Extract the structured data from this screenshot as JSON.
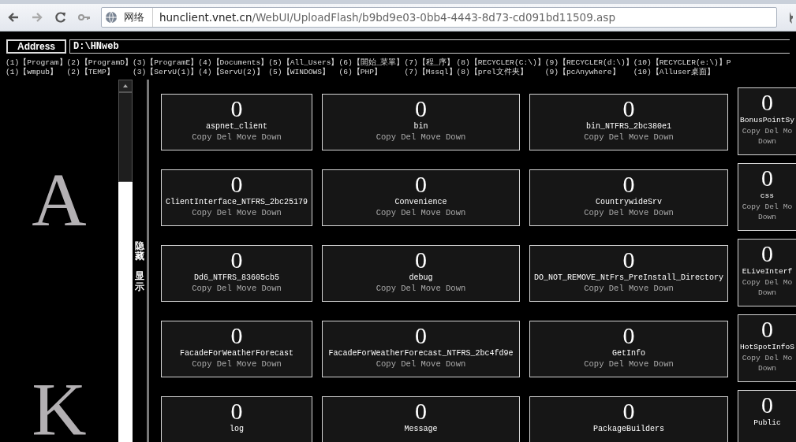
{
  "browser": {
    "address_label": "网络",
    "url_host": "hunclient.vnet.cn",
    "url_path": "/WebUI/UploadFlash/b9bd9e03-0bb4-4443-8d73-cd091bd11509.asp"
  },
  "address_bar": {
    "label": "Address",
    "value": "D:\\HNweb"
  },
  "quick_links": [
    [
      "(1)【Program】",
      "(2)【ProgramD】",
      "(3)【ProgramE】",
      "(4)【Documents】",
      "(5)【All_Users】",
      "(6)【開始_菜單】",
      "(7)【程_序】",
      "(8)【RECYCLER(C:\\)】",
      "(9)【RECYCLER(d:\\)】",
      "(10)【RECYCLER(e:\\)】",
      "P"
    ],
    [
      "(1)【wmpub】",
      "(2)【TEMP】",
      "(3)【ServU(1)】",
      "(4)【ServU(2)】",
      "(5)【WINDOWS】",
      "(6)【PHP】",
      "(7)【Mssql】",
      "(8)【prel文件夹】",
      "(9)【pcAnywhere】",
      "(10)【Alluser桌面】"
    ]
  ],
  "index_letters": [
    "A",
    "K"
  ],
  "toggle": {
    "hide": "隐藏",
    "show": "显示"
  },
  "folders": [
    {
      "count": "0",
      "name": "aspnet_client",
      "actions": [
        "Copy",
        "Del",
        "Move",
        "Down"
      ]
    },
    {
      "count": "0",
      "name": "bin",
      "actions": [
        "Copy",
        "Del",
        "Move",
        "Down"
      ]
    },
    {
      "count": "0",
      "name": "bin_NTFRS_2bc380e1",
      "actions": [
        "Copy",
        "Del",
        "Move",
        "Down"
      ]
    },
    {
      "count": "0",
      "name": "BonusPointSy",
      "actions": [
        "Copy",
        "Del",
        "Mo",
        "Down"
      ]
    },
    {
      "count": "0",
      "name": "ClientInterface_NTFRS_2bc25179",
      "actions": [
        "Copy",
        "Del",
        "Move",
        "Down"
      ]
    },
    {
      "count": "0",
      "name": "Convenience",
      "actions": [
        "Copy",
        "Del",
        "Move",
        "Down"
      ]
    },
    {
      "count": "0",
      "name": "CountrywideSrv",
      "actions": [
        "Copy",
        "Del",
        "Move",
        "Down"
      ]
    },
    {
      "count": "0",
      "name": "css",
      "actions": [
        "Copy",
        "Del",
        "Mo",
        "Down"
      ]
    },
    {
      "count": "0",
      "name": "Dd6_NTFRS_83605cb5",
      "actions": [
        "Copy",
        "Del",
        "Move",
        "Down"
      ]
    },
    {
      "count": "0",
      "name": "debug",
      "actions": [
        "Copy",
        "Del",
        "Move",
        "Down"
      ]
    },
    {
      "count": "0",
      "name": "DO_NOT_REMOVE_NtFrs_PreInstall_Directory",
      "actions": [
        "Copy",
        "Del",
        "Move",
        "Down"
      ]
    },
    {
      "count": "0",
      "name": "ELiveInterf",
      "actions": [
        "Copy",
        "Del",
        "Mo",
        "Down"
      ]
    },
    {
      "count": "0",
      "name": "FacadeForWeatherForecast",
      "actions": [
        "Copy",
        "Del",
        "Move",
        "Down"
      ]
    },
    {
      "count": "0",
      "name": "FacadeForWeatherForecast_NTFRS_2bc4fd9e",
      "actions": [
        "Copy",
        "Del",
        "Move",
        "Down"
      ]
    },
    {
      "count": "0",
      "name": "GetInfo",
      "actions": [
        "Copy",
        "Del",
        "Move",
        "Down"
      ]
    },
    {
      "count": "0",
      "name": "HotSpotInfoS",
      "actions": [
        "Copy",
        "Del",
        "Mo",
        "Down"
      ]
    },
    {
      "count": "0",
      "name": "log"
    },
    {
      "count": "0",
      "name": "Message"
    },
    {
      "count": "0",
      "name": "PackageBuilders"
    },
    {
      "count": "0",
      "name": "Public"
    }
  ]
}
